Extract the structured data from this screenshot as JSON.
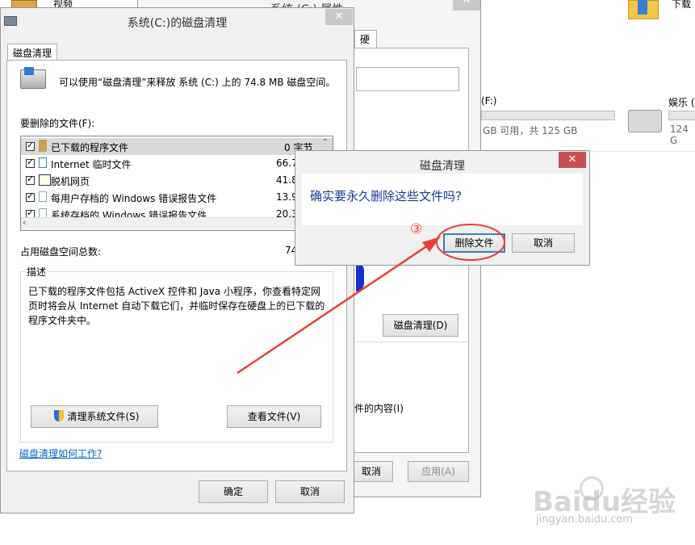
{
  "background": {
    "top_left_label": "视频",
    "top_right_label": "下载",
    "drive_f_label": "(F:)",
    "drive_f_free": "GB 可用，共 125 GB",
    "drive_yule_label": "娱乐 (",
    "drive_yule_free": "124 G"
  },
  "properties": {
    "title": "系统 (C:) 属性",
    "tab_label": "硬",
    "disk_cleanup_button": "磁盘清理(D)",
    "index_text": "件的内容(I)",
    "cancel_label": "取消",
    "apply_label": "应用(A)"
  },
  "cleanup": {
    "title": "系统(C:)的磁盘清理",
    "tab": "磁盘清理",
    "summary": "可以使用“磁盘清理”来释放 系统 (C:) 上的 74.8 MB 磁盘空间。",
    "files_heading": "要删除的文件(F):",
    "items": [
      {
        "label": "已下载的程序文件",
        "size": "0 字节"
      },
      {
        "label": "Internet 临时文件",
        "size": "66.7"
      },
      {
        "label": "脱机网页",
        "size": "41.8"
      },
      {
        "label": "每用户存档的 Windows 错误报告文件",
        "size": "13.9"
      },
      {
        "label": "系统存档的 Windows 错误报告文件",
        "size": "20.3"
      }
    ],
    "total_label": "占用磁盘空间总数:",
    "total_value": "74",
    "desc_heading": "描述",
    "description": "已下载的程序文件包括 ActiveX 控件和 Java 小程序，你查看特定网页时将会从 Internet 自动下载它们，并临时保存在硬盘上的已下载的程序文件夹中。",
    "clean_system_button": "清理系统文件(S)",
    "view_files_button": "查看文件(V)",
    "help_link": "磁盘清理如何工作?",
    "ok_button": "确定",
    "cancel_button": "取消"
  },
  "confirm": {
    "title": "磁盘清理",
    "question": "确实要永久删除这些文件吗?",
    "delete_button": "删除文件",
    "cancel_button": "取消",
    "step_marker": "③"
  },
  "watermark": {
    "brand": "Baidu经验",
    "url": "jingyan.baidu.com"
  },
  "colors": {
    "accent_red": "#e8403a",
    "close_red": "#c75050",
    "question_blue": "#1a3a9a"
  }
}
